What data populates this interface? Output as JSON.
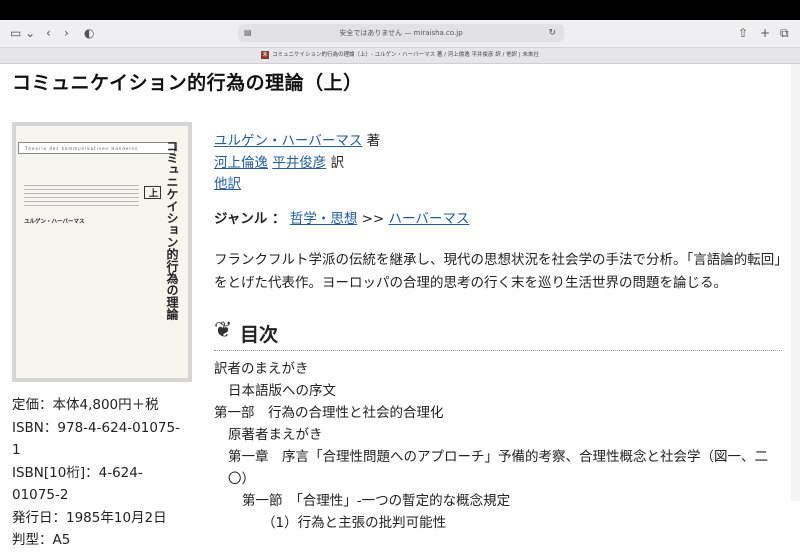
{
  "browser": {
    "address": "安全ではありません — miraisha.co.jp",
    "tab_title": "コミュニケイション的行為の理論（上）- ユルゲン・ハーバーマス 著 / 河上倫逸 平井俊彦 訳 / 他訳 | 未來社",
    "favicon_letter": "未"
  },
  "page": {
    "title": "コミュニケイション的行為の理論（上）"
  },
  "cover": {
    "header_text": "Theorie des kommunikativen Handelns",
    "title": "コミュニケイション的行為の理論",
    "volume": "上",
    "author": "ユルゲン・ハーバーマス"
  },
  "book": {
    "author": "ユルゲン・ハーバーマス",
    "author_suffix": "著",
    "translator1": "河上倫逸",
    "translator2": "平井俊彦",
    "translator_suffix": "訳",
    "others": "他訳",
    "genre_label": "ジャンル ：",
    "genre1": "哲学・思想",
    "genre_sep": ">>",
    "genre2": "ハーバーマス",
    "description": "フランクフルト学派の伝統を継承し、現代の思想状況を社会学の手法で分析。「言語論的転回」をとげた代表作。ヨーロッパの合理的思考の行く末を巡り生活世界の問題を論じる。"
  },
  "meta": {
    "price": "定価：本体4,800円＋税",
    "isbn_1": "ISBN：978-4-624-01075-",
    "isbn_2": "1",
    "isbn10_1": "ISBN[10桁]：4-624-",
    "isbn10_2": "01075-2",
    "date": "発行日：1985年10月2日",
    "format": "判型：A5"
  },
  "toc": {
    "heading": "目次",
    "items": [
      "訳者のまえがき",
      "日本語版への序文",
      "第一部　行為の合理性と社会的合理化",
      "原著者まえがき",
      "第一章　序言「合理性問題へのアプローチ」予備的考察、合理性概念と社会学（図一、二〇）",
      "第一節　「合理性」-一つの暫定的な概念規定",
      "（1）行為と主張の批判可能性"
    ]
  }
}
